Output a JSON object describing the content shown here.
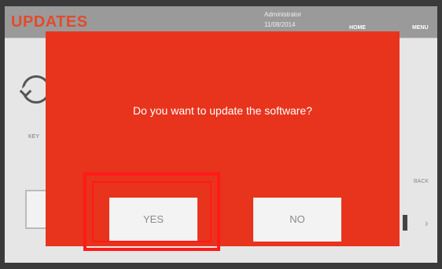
{
  "header": {
    "title": "UPDATES",
    "user_line1": "Administrator",
    "user_line2": "11/08/2014",
    "nav_home": "HOME",
    "nav_menu": "MENU"
  },
  "background": {
    "key_label": "KEY",
    "back_label": "BACK",
    "arrow": "›"
  },
  "dialog": {
    "message": "Do you want to update the software?",
    "yes_label": "YES",
    "no_label": "NO",
    "background_color": "#e8341c",
    "highlight_color": "#ff1a1a"
  }
}
